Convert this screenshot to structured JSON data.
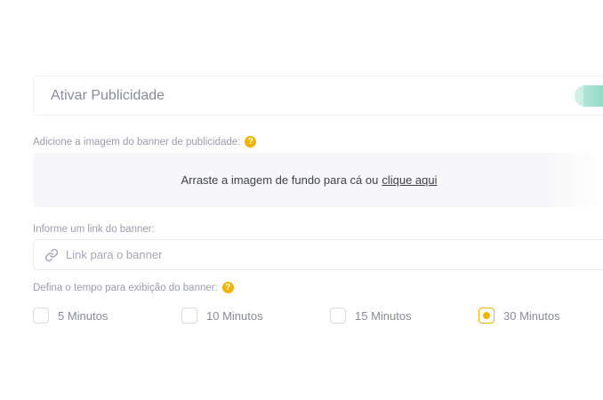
{
  "ads_toggle": {
    "label": "Ativar Publicidade",
    "enabled": true,
    "color": "#8fd9c3"
  },
  "banner_image": {
    "label": "Adicione a imagem do banner de publicidade:",
    "dropzone_text": "Arraste a imagem de fundo para cá ou",
    "dropzone_link": "clique aqui"
  },
  "banner_link": {
    "label": "Informe um link do banner:",
    "placeholder": "Link para o banner",
    "value": "",
    "icon": "link-icon"
  },
  "display_time": {
    "label": "Defina o tempo para exibição do banner:",
    "options": [
      {
        "label": "5 Minutos",
        "selected": false
      },
      {
        "label": "10 Minutos",
        "selected": false
      },
      {
        "label": "15 Minutos",
        "selected": false
      },
      {
        "label": "30 Minutos",
        "selected": true
      }
    ]
  },
  "accent_color": "#f2b301"
}
